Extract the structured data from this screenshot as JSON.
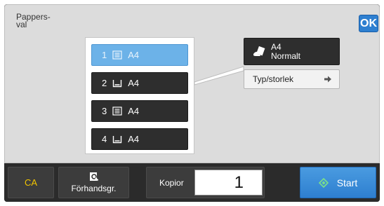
{
  "header": {
    "title": "Pappers-\nval",
    "ok_label": "OK"
  },
  "trays": [
    {
      "number": "1",
      "size": "A4",
      "icon": "tray-stack-icon",
      "selected": true
    },
    {
      "number": "2",
      "size": "A4",
      "icon": "tray-bin-icon",
      "selected": false
    },
    {
      "number": "3",
      "size": "A4",
      "icon": "tray-stack-icon",
      "selected": false
    },
    {
      "number": "4",
      "size": "A4",
      "icon": "tray-bin-icon",
      "selected": false
    }
  ],
  "paper_info": {
    "size": "A4",
    "type": "Normalt",
    "icon": "manual-feed-hand-icon"
  },
  "type_size_button": {
    "label": "Typ/storlek",
    "icon": "arrow-right-icon"
  },
  "bottom": {
    "ca_label": "CA",
    "preview_label": "Förhandsgr.",
    "preview_icon": "magnifier-preview-icon",
    "copies_label": "Kopior",
    "copies_value": "1",
    "start_label": "Start",
    "start_icon": "diamond-start-icon"
  },
  "colors": {
    "accent_blue": "#2e7fd0",
    "selected_tray": "#6cb2e8",
    "dark_button": "#2e2e2e",
    "ca_yellow": "#f2c400"
  }
}
